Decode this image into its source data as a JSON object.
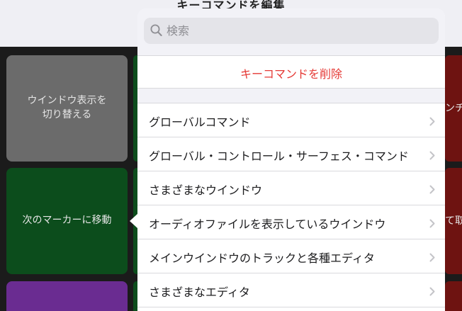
{
  "header": {
    "title": "キーコマンドを編集"
  },
  "pads": {
    "toggle_window": "ウインドウ表示を\n切り替える",
    "next_marker": "次のマーカーに移動",
    "right_top_partial": "ンチ",
    "right_mid_partial": "て取"
  },
  "popover": {
    "search": {
      "placeholder": "検索"
    },
    "delete_label": "キーコマンドを削除",
    "items": [
      {
        "label": "グローバルコマンド"
      },
      {
        "label": "グローバル・コントロール・サーフェス・コマンド"
      },
      {
        "label": "さまざまなウインドウ"
      },
      {
        "label": "オーディオファイルを表示しているウインドウ"
      },
      {
        "label": "メインウインドウのトラックと各種エディタ"
      },
      {
        "label": "さまざまなエディタ"
      }
    ]
  },
  "colors": {
    "delete": "#e53935",
    "pad_gray": "#6b6b6b",
    "pad_green": "#0c4d1c",
    "pad_purple": "#6a2c91",
    "pad_red": "#6e1311"
  }
}
